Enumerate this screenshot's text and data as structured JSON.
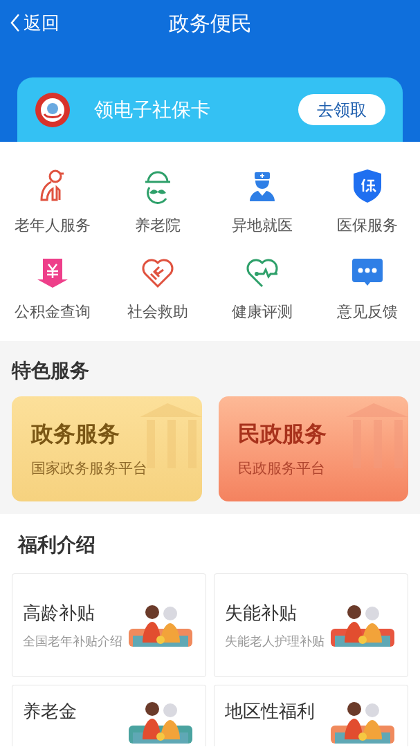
{
  "nav": {
    "back": "返回",
    "title": "政务便民"
  },
  "banner": {
    "title": "领电子社保卡",
    "button": "去领取"
  },
  "services": [
    {
      "label": "老年人服务"
    },
    {
      "label": "养老院"
    },
    {
      "label": "异地就医"
    },
    {
      "label": "医保服务"
    },
    {
      "label": "公积金查询"
    },
    {
      "label": "社会救助"
    },
    {
      "label": "健康评测"
    },
    {
      "label": "意见反馈"
    }
  ],
  "featured": {
    "heading": "特色服务",
    "cards": [
      {
        "kind": "gov",
        "title": "政务服务",
        "subtitle": "国家政务服务平台"
      },
      {
        "kind": "civil",
        "title": "民政服务",
        "subtitle": "民政服务平台"
      }
    ]
  },
  "welfare": {
    "heading": "福利介绍",
    "cards": [
      {
        "title": "高龄补贴",
        "subtitle": "全国老年补贴介绍"
      },
      {
        "title": "失能补贴",
        "subtitle": "失能老人护理补贴"
      },
      {
        "title": "养老金"
      },
      {
        "title": "地区性福利"
      }
    ]
  }
}
